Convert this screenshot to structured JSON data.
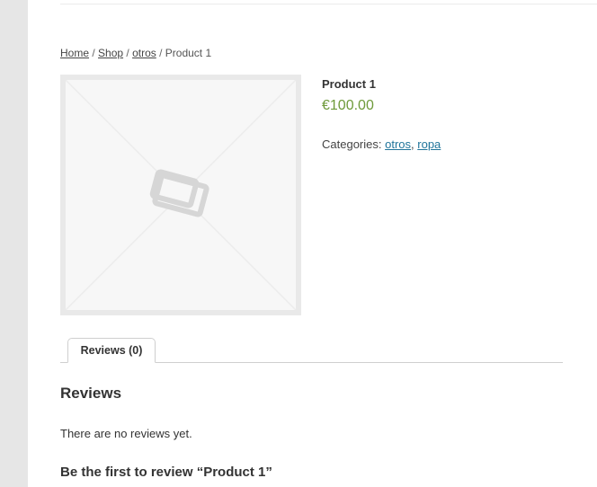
{
  "breadcrumb": {
    "home": "Home",
    "shop": "Shop",
    "category": "otros",
    "current": "Product 1",
    "separator": " / "
  },
  "product": {
    "title": "Product 1",
    "price": "€100.00",
    "categories_label": "Categories:",
    "categories": [
      "otros",
      "ropa"
    ],
    "categories_separator": ","
  },
  "image": {
    "icon": "placeholder-image-icon"
  },
  "tabs": [
    {
      "label": "Reviews (0)",
      "active": true
    }
  ],
  "reviews": {
    "heading": "Reviews",
    "empty_text": "There are no reviews yet.",
    "prompt": "Be the first to review “Product 1”"
  },
  "colors": {
    "price": "#6e9a3a",
    "link": "#21759b",
    "sidebar_bg": "#e6e6e6"
  }
}
